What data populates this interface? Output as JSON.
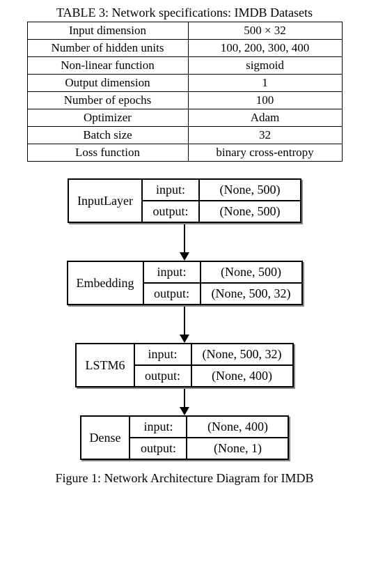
{
  "table": {
    "caption": "TABLE 3: Network specifications: IMDB Datasets",
    "rows": [
      {
        "key": "Input dimension",
        "val": "500 × 32"
      },
      {
        "key": "Number of hidden units",
        "val": "100, 200, 300, 400"
      },
      {
        "key": "Non-linear function",
        "val": "sigmoid"
      },
      {
        "key": "Output dimension",
        "val": "1"
      },
      {
        "key": "Number of epochs",
        "val": "100"
      },
      {
        "key": "Optimizer",
        "val": "Adam"
      },
      {
        "key": "Batch size",
        "val": "32"
      },
      {
        "key": "Loss function",
        "val": "binary cross-entropy"
      }
    ]
  },
  "diagram": {
    "layers": [
      {
        "name": "InputLayer",
        "input": "(None, 500)",
        "output": "(None, 500)"
      },
      {
        "name": "Embedding",
        "input": "(None, 500)",
        "output": "(None, 500, 32)"
      },
      {
        "name": "LSTM6",
        "input": "(None, 500, 32)",
        "output": "(None, 400)"
      },
      {
        "name": "Dense",
        "input": "(None, 400)",
        "output": "(None, 1)"
      }
    ],
    "io_labels": {
      "in": "input:",
      "out": "output:"
    }
  },
  "figure_caption": "Figure 1: Network Architecture Diagram for IMDB"
}
